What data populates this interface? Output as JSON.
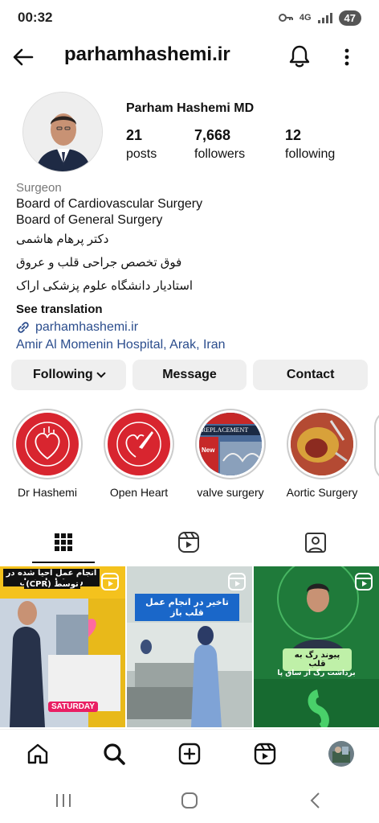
{
  "status": {
    "time": "00:32",
    "network": "4G",
    "battery": "47"
  },
  "header": {
    "username": "parhamhashemi.ir"
  },
  "profile": {
    "display_name": "Parham Hashemi MD",
    "posts_count": "21",
    "posts_label": "posts",
    "followers_count": "7,668",
    "followers_label": "followers",
    "following_count": "12",
    "following_label": "following"
  },
  "bio": {
    "category": "Surgeon",
    "line1": "Board of Cardiovascular Surgery",
    "line2": "Board of General Surgery",
    "fa1": "دکتر پرهام هاشمی",
    "fa2": "فوق تخصص جراحی قلب و عروق",
    "fa3": "استادیار دانشگاه علوم پزشکی اراک",
    "see_translation": "See translation",
    "link": "parhamhashemi.ir",
    "location": "Amir Al Momenin Hospital, Arak, Iran"
  },
  "buttons": {
    "following": "Following",
    "message": "Message",
    "contact": "Contact"
  },
  "highlights": [
    {
      "label": "Dr Hashemi"
    },
    {
      "label": "Open Heart"
    },
    {
      "label": "valve surgery"
    },
    {
      "label": "Aortic Surgery"
    }
  ],
  "highlight_text": {
    "replacement": "REPLACEMENT",
    "new": "New"
  },
  "posts": [
    {
      "top_text": "انجام عمل احیا شده در روز قبل از عمل",
      "top_text2": "(CPR) توسط",
      "badge": "SATURDAY"
    },
    {
      "top_text": "تاخیر در انجام عمل قلب باز"
    },
    {
      "title": "پیوند رگ به قلب",
      "subtitle": "برداشت رگ از ساق پا"
    }
  ],
  "colors": {
    "link": "#2b4d8d",
    "button_bg": "#efefef",
    "highlight_red": "#d8252f",
    "post_green": "#1f7a3a"
  }
}
